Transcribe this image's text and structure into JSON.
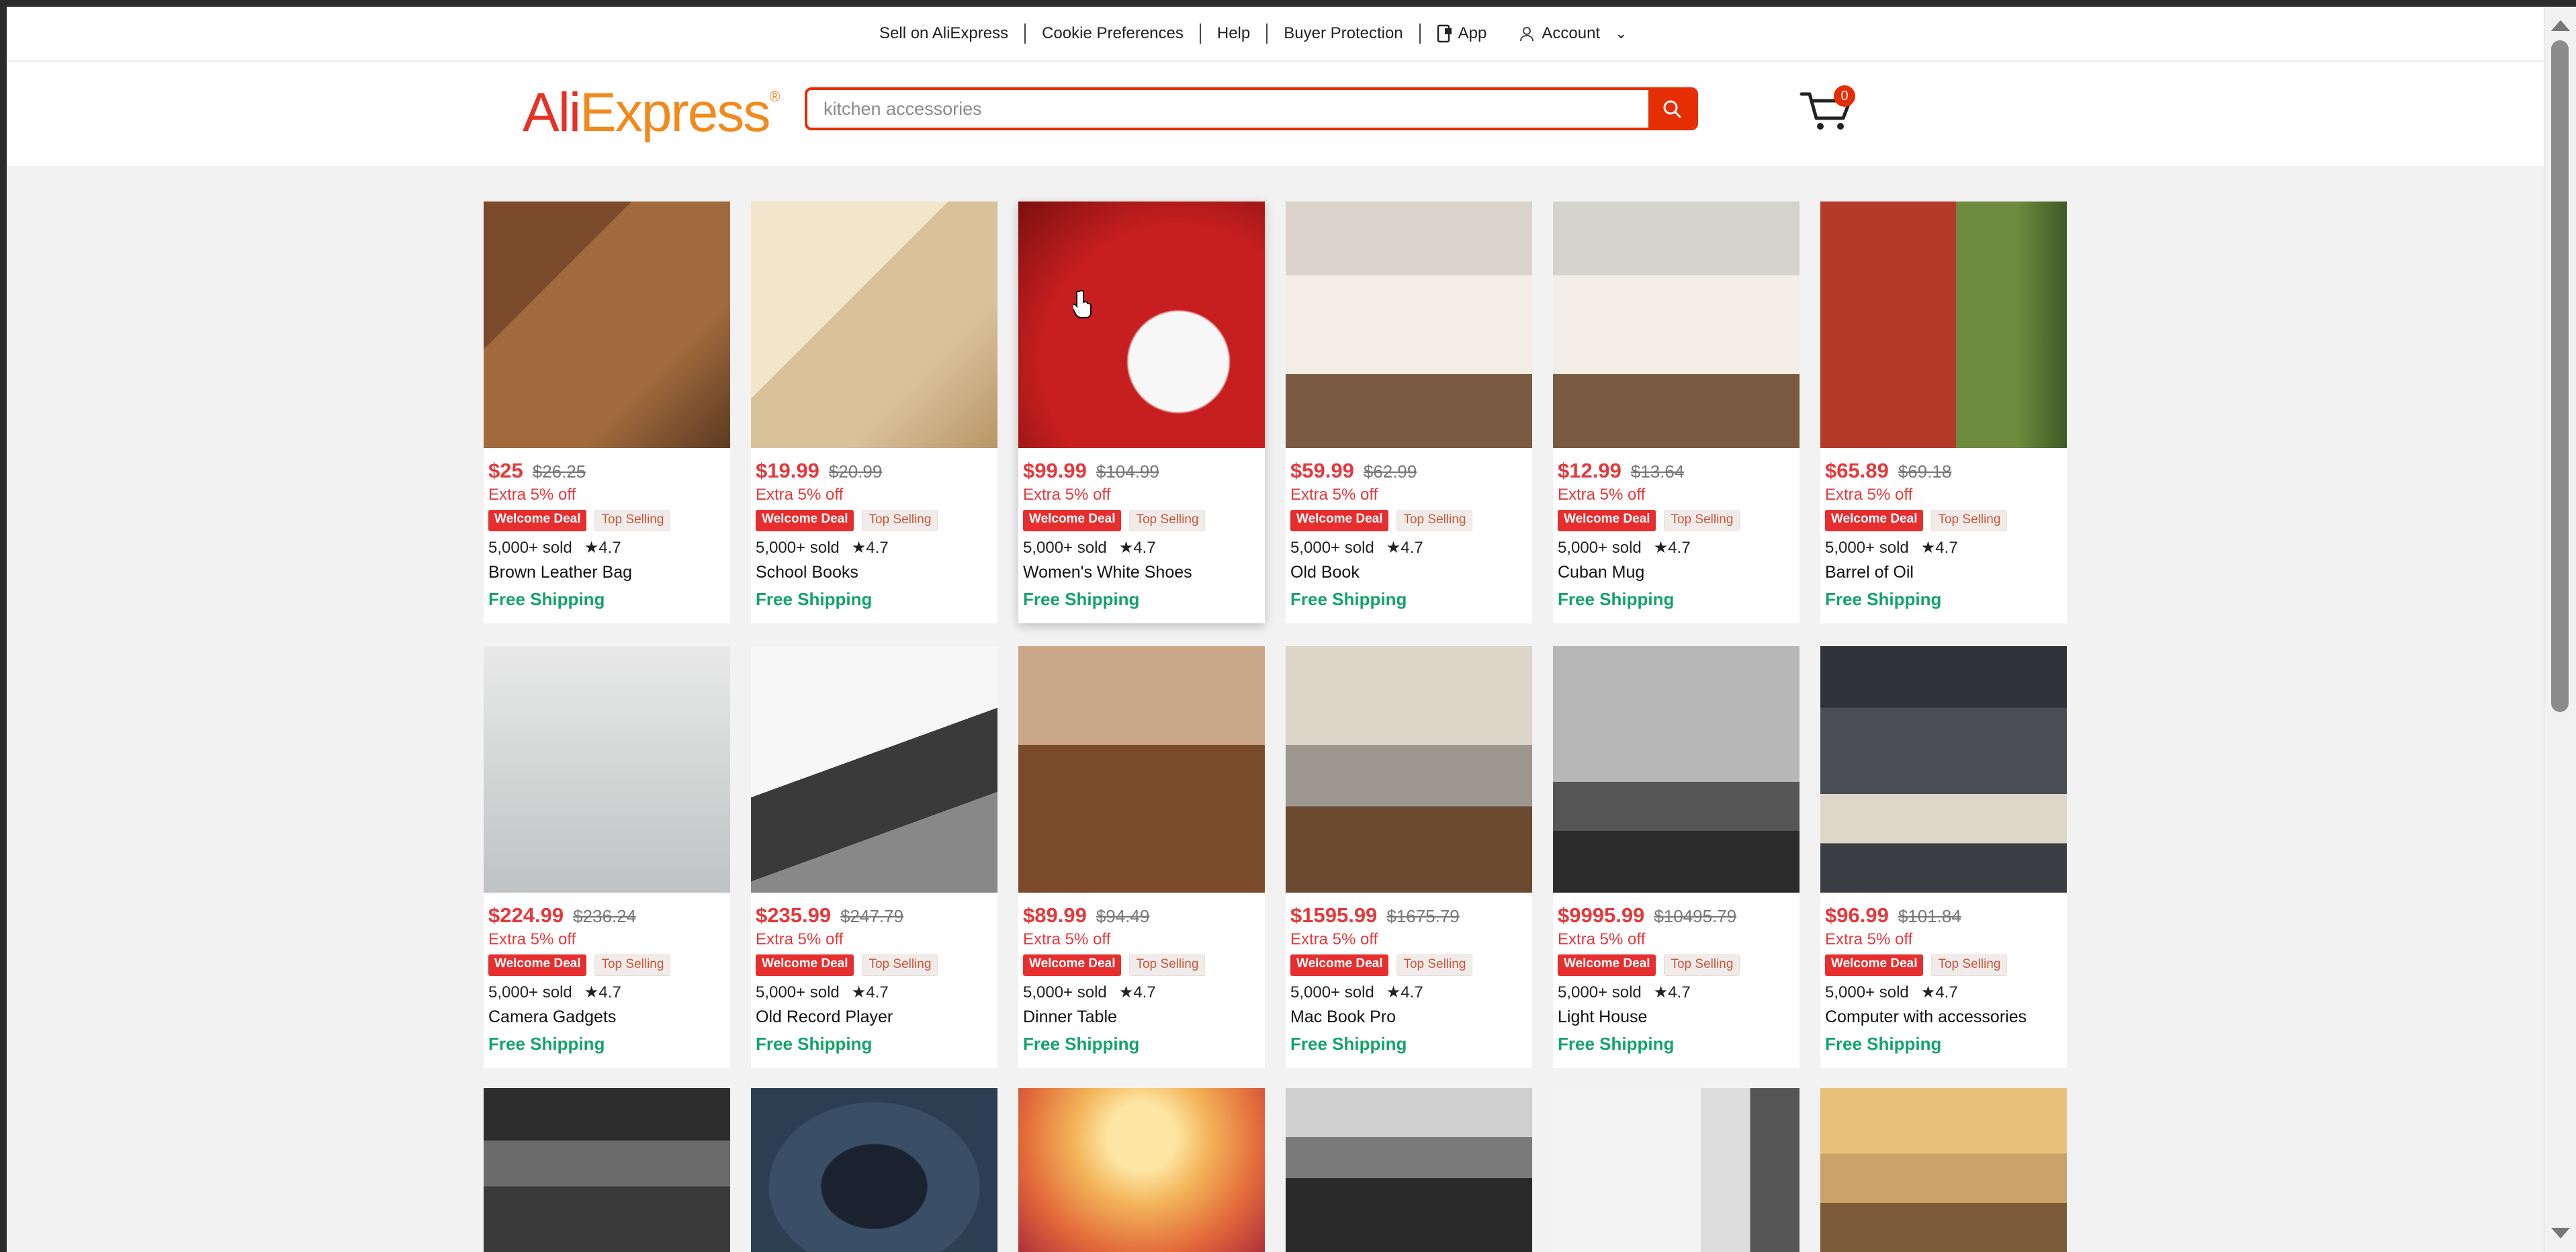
{
  "top_nav": {
    "sell": "Sell on AliExpress",
    "cookie": "Cookie Preferences",
    "help": "Help",
    "buyer_protection": "Buyer Protection",
    "app": "App",
    "account": "Account"
  },
  "header": {
    "logo_ali": "Ali",
    "logo_express": "Express",
    "logo_reg": "®",
    "search_placeholder": "kitchen accessories",
    "cart_count": "0"
  },
  "colors": {
    "accent": "#e62e04",
    "price": "#e4393c",
    "shipping": "#14a36b",
    "logo_ali": "#e43225",
    "logo_express": "#f08a1c"
  },
  "product_labels": {
    "extra": "Extra 5% off",
    "welcome": "Welcome Deal",
    "top": "Top Selling",
    "sold": "5,000+ sold",
    "rating": "★4.7",
    "shipping": "Free Shipping"
  },
  "products": [
    {
      "price": "$25",
      "orig": "$26.25",
      "name": "Brown Leather Bag"
    },
    {
      "price": "$19.99",
      "orig": "$20.99",
      "name": "School Books"
    },
    {
      "price": "$99.99",
      "orig": "$104.99",
      "name": "Women's White Shoes"
    },
    {
      "price": "$59.99",
      "orig": "$62.99",
      "name": "Old Book"
    },
    {
      "price": "$12.99",
      "orig": "$13.64",
      "name": "Cuban Mug"
    },
    {
      "price": "$65.89",
      "orig": "$69.18",
      "name": "Barrel of Oil"
    },
    {
      "price": "$224.99",
      "orig": "$236.24",
      "name": "Camera Gadgets"
    },
    {
      "price": "$235.99",
      "orig": "$247.79",
      "name": "Old Record Player"
    },
    {
      "price": "$89.99",
      "orig": "$94.49",
      "name": "Dinner Table"
    },
    {
      "price": "$1595.99",
      "orig": "$1675.79",
      "name": "Mac Book Pro"
    },
    {
      "price": "$9995.99",
      "orig": "$10495.79",
      "name": "Light House"
    },
    {
      "price": "$96.99",
      "orig": "$101.84",
      "name": "Computer with accessories"
    }
  ]
}
